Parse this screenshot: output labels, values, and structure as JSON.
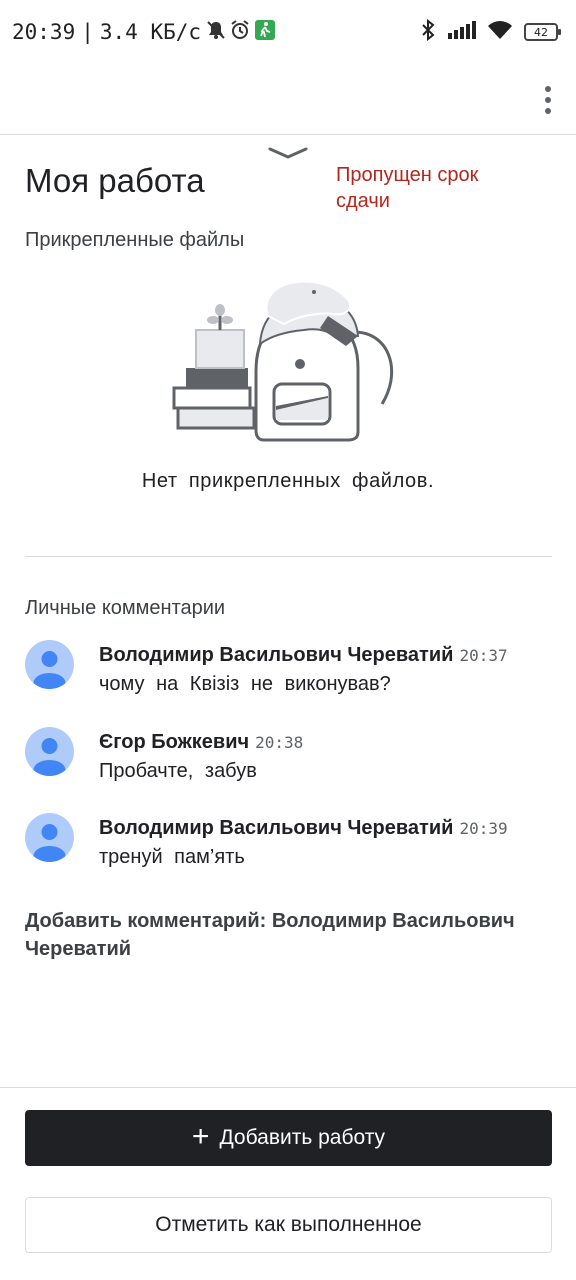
{
  "status_bar": {
    "time": "20:39",
    "separator": "|",
    "network_speed": "3.4 КБ/с",
    "battery_level": "42",
    "icons": [
      "mute-icon",
      "alarm-icon",
      "walking-icon",
      "bluetooth-icon",
      "signal-icon",
      "wifi-icon",
      "battery-icon"
    ]
  },
  "app_bar": {
    "menu_icon": "more-vertical-icon"
  },
  "work": {
    "title": "Моя работа",
    "status": "Пропущен срок сдачи",
    "status_color": "#b3261e",
    "attached_heading": "Прикрепленные файлы",
    "no_files_text": "Нет прикрепленных файлов."
  },
  "comments": {
    "heading": "Личные комментарии",
    "items": [
      {
        "author": "Володимир Васильович Череватий",
        "time": "20:37",
        "text": "чому на Квізіз не виконував?"
      },
      {
        "author": "Єгор Божкевич",
        "time": "20:38",
        "text": "Пробачте, забув"
      },
      {
        "author": "Володимир Васильович Череватий",
        "time": "20:39",
        "text": "тренуй пам’ять"
      }
    ],
    "add_comment": "Добавить комментарий: Володимир Васильович Череватий"
  },
  "actions": {
    "add_work": "Добавить работу",
    "mark_done": "Отметить как выполненное"
  },
  "colors": {
    "primary_button": "#202124",
    "avatar_bg": "#aecbfa",
    "avatar_fg": "#4285f4"
  }
}
